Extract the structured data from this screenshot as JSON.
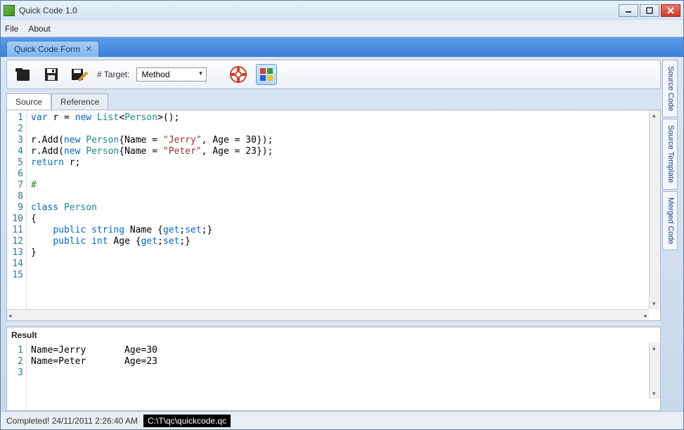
{
  "window": {
    "title": "Quick Code 1.0"
  },
  "menu": {
    "file": "File",
    "about": "About"
  },
  "docTab": {
    "label": "Quick Code Form"
  },
  "toolbar": {
    "target_label": "# Target:",
    "target_value": "Method"
  },
  "tabs": {
    "source": "Source",
    "reference": "Reference"
  },
  "sideTabs": {
    "source_code": "Source Code",
    "source_template": "Source Template",
    "merged_code": "Merged Code"
  },
  "editor": {
    "line_count": 15,
    "tokens": [
      [
        {
          "t": "var ",
          "c": "kw"
        },
        {
          "t": "r = ",
          "c": ""
        },
        {
          "t": "new ",
          "c": "kw"
        },
        {
          "t": "List",
          "c": "type"
        },
        {
          "t": "<",
          "c": ""
        },
        {
          "t": "Person",
          "c": "type"
        },
        {
          "t": ">();",
          "c": ""
        }
      ],
      [],
      [
        {
          "t": "r.Add(",
          "c": ""
        },
        {
          "t": "new ",
          "c": "kw"
        },
        {
          "t": "Person",
          "c": "type"
        },
        {
          "t": "{Name = ",
          "c": ""
        },
        {
          "t": "\"Jerry\"",
          "c": "str"
        },
        {
          "t": ", Age = ",
          "c": ""
        },
        {
          "t": "30",
          "c": "num"
        },
        {
          "t": "});",
          "c": ""
        }
      ],
      [
        {
          "t": "r.Add(",
          "c": ""
        },
        {
          "t": "new ",
          "c": "kw"
        },
        {
          "t": "Person",
          "c": "type"
        },
        {
          "t": "{Name = ",
          "c": ""
        },
        {
          "t": "\"Peter\"",
          "c": "str"
        },
        {
          "t": ", Age = ",
          "c": ""
        },
        {
          "t": "23",
          "c": "num"
        },
        {
          "t": "});",
          "c": ""
        }
      ],
      [
        {
          "t": "return ",
          "c": "kw"
        },
        {
          "t": "r;",
          "c": ""
        }
      ],
      [],
      [
        {
          "t": "#",
          "c": "cmt"
        }
      ],
      [],
      [
        {
          "t": "class ",
          "c": "kw"
        },
        {
          "t": "Person",
          "c": "type"
        }
      ],
      [
        {
          "t": "{",
          "c": ""
        }
      ],
      [
        {
          "t": "    ",
          "c": ""
        },
        {
          "t": "public ",
          "c": "kw"
        },
        {
          "t": "string ",
          "c": "kw"
        },
        {
          "t": "Name {",
          "c": ""
        },
        {
          "t": "get",
          "c": "kw"
        },
        {
          "t": ";",
          "c": ""
        },
        {
          "t": "set",
          "c": "kw"
        },
        {
          "t": ";}",
          "c": ""
        }
      ],
      [
        {
          "t": "    ",
          "c": ""
        },
        {
          "t": "public ",
          "c": "kw"
        },
        {
          "t": "int ",
          "c": "kw"
        },
        {
          "t": "Age {",
          "c": ""
        },
        {
          "t": "get",
          "c": "kw"
        },
        {
          "t": ";",
          "c": ""
        },
        {
          "t": "set",
          "c": "kw"
        },
        {
          "t": ";}",
          "c": ""
        }
      ],
      [
        {
          "t": "}",
          "c": ""
        }
      ],
      [],
      []
    ]
  },
  "result": {
    "title": "Result",
    "line_count": 3,
    "lines": [
      "Name=Jerry       Age=30",
      "Name=Peter       Age=23",
      ""
    ]
  },
  "status": {
    "message": "Completed! 24/11/2011 2:26:40 AM",
    "path": "C:\\T\\qc\\quickcode.qc"
  }
}
